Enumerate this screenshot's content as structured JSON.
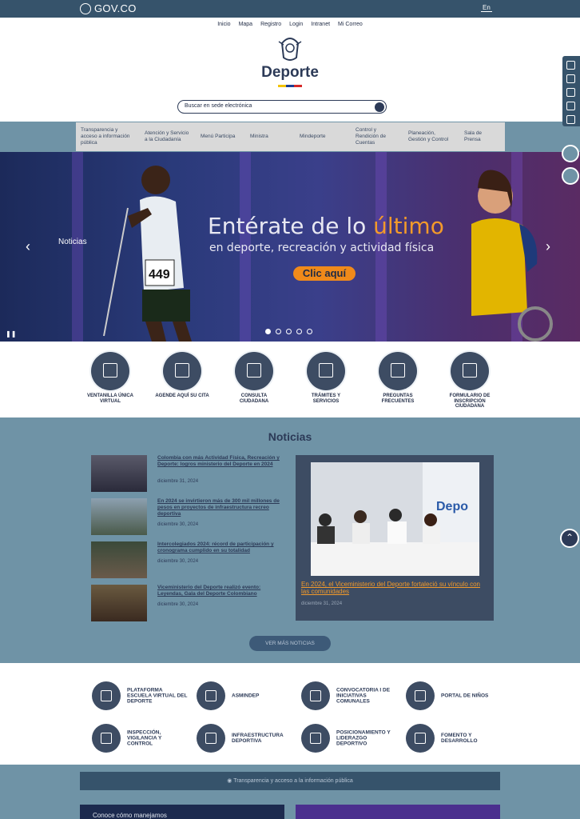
{
  "gov": {
    "logo": "GOV.CO",
    "lang": "En"
  },
  "top_links": [
    "Inicio",
    "Mapa",
    "Registro",
    "Login",
    "Intranet",
    "Mi Correo"
  ],
  "brand": {
    "name": "Deporte",
    "stripe_colors": [
      "#f2c200",
      "#1c3f94",
      "#d62828"
    ]
  },
  "search": {
    "placeholder": "Buscar en sede electrónica"
  },
  "nav": [
    "Transparencia y acceso a información pública",
    "Atención y Servicio a la Ciudadanía",
    "Menú Participa",
    "Ministra",
    "Mindeporte",
    "Control y Rendición de Cuentas",
    "Planeación, Gestión y Control",
    "Sala de Prensa"
  ],
  "hero": {
    "label": "Noticias",
    "headline_start": "Entérate de lo ",
    "headline_highlight": "último",
    "subheadline": "en deporte, recreación y actividad física",
    "cta": "Clic aquí",
    "bib_number": "449",
    "slides": 5,
    "active_slide": 1
  },
  "quick_access": [
    "Ventanilla Única Virtual",
    "Agende aquí su cita",
    "Consulta Ciudadana",
    "Trámites y Servicios",
    "Preguntas Frecuentes",
    "Formulario de Inscripción Ciudadana"
  ],
  "news": {
    "heading": "Noticias",
    "items": [
      {
        "title": "Colombia con más Actividad Física, Recreación y Deporte: logros ministerio del Deporte en 2024",
        "date": "diciembre 31, 2024"
      },
      {
        "title": "En 2024 se invirtieron más de 300 mil millones de pesos en proyectos de infraestructura recreo deportiva",
        "date": "diciembre 30, 2024"
      },
      {
        "title": "Intercolegiados 2024: récord de participación y cronograma cumplido en su totalidad",
        "date": "diciembre 30, 2024"
      },
      {
        "title": "Viceministerio del Deporte realizó evento: Leyendas, Gala del Deporte Colombiano",
        "date": "diciembre 30, 2024"
      }
    ],
    "featured": {
      "title": "En 2024, el Viceministerio del Deporte fortaleció su vínculo con las comunidades",
      "date": "diciembre 31, 2024",
      "banner_text": "Depo"
    },
    "more_button": "VER MÁS NOTICIAS"
  },
  "services": [
    "Plataforma Escuela Virtual del Deporte",
    "ASMINDEP",
    "Convocatoria I de Iniciativas Comunales",
    "Portal de Niños",
    "Inspección, Vigilancia y Control",
    "Infraestructura Deportiva",
    "Posicionamiento y Liderazgo Deportivo",
    "Fomento y Desarrollo"
  ],
  "transparency_bar": "Transparencia y acceso a la información pública",
  "cards": {
    "left": "Conoce cómo manejamos"
  }
}
